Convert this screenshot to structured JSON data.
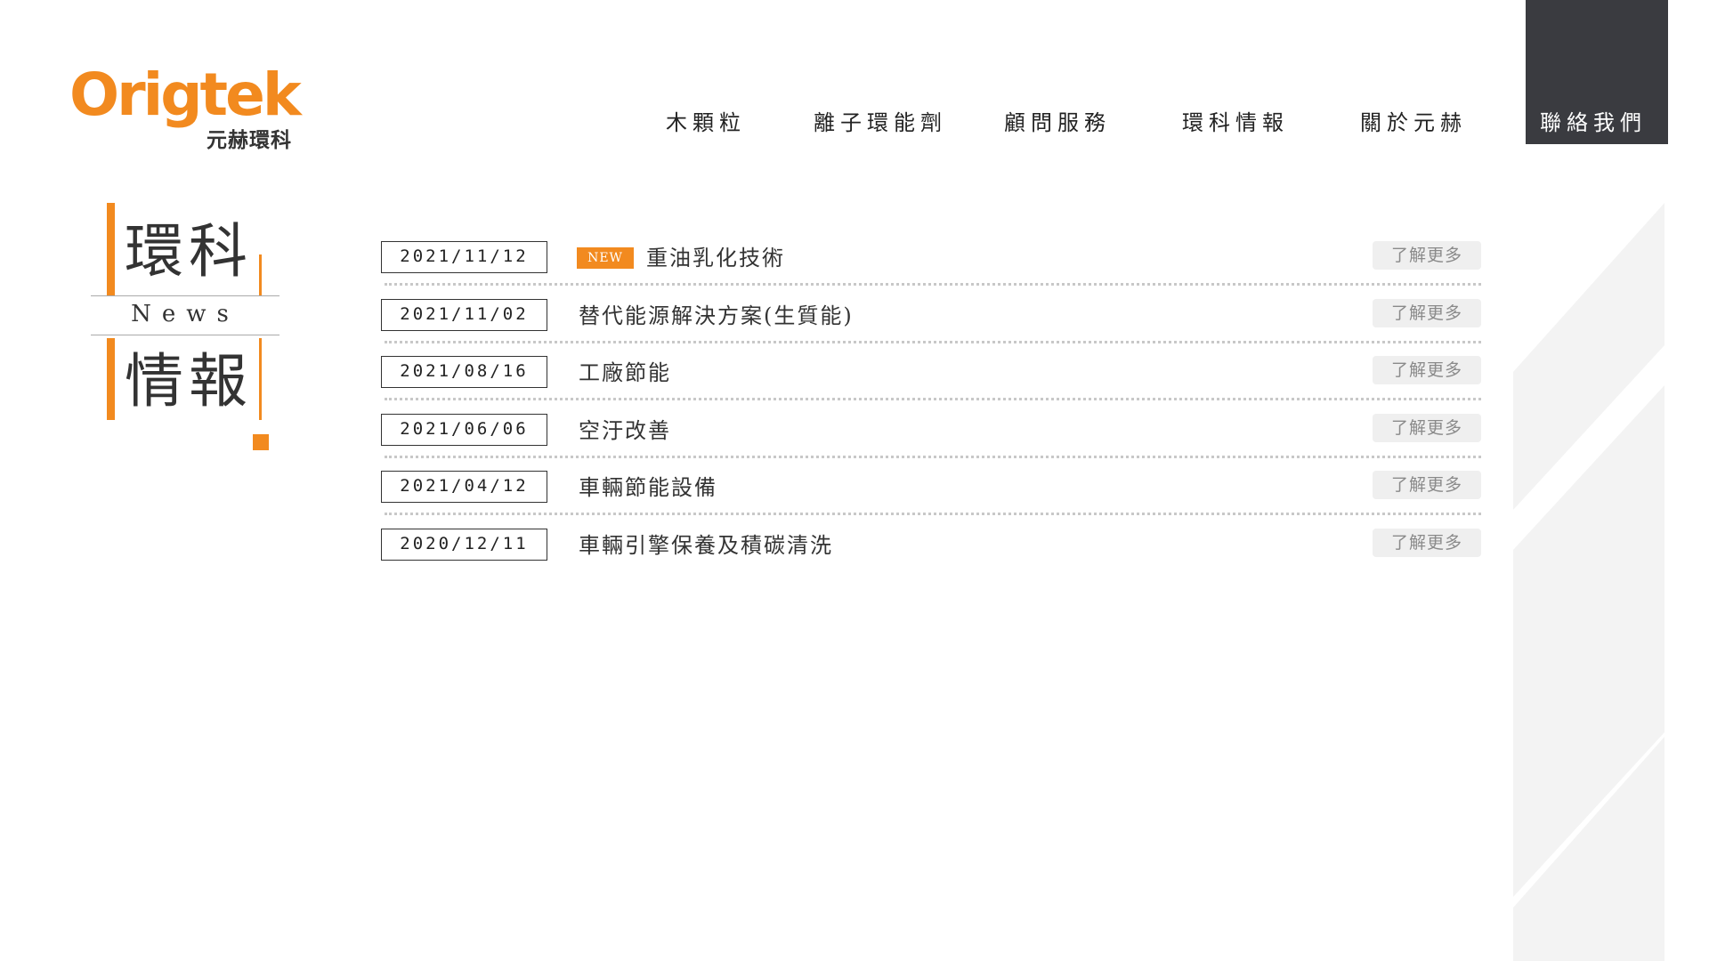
{
  "brand": {
    "logo_text": "Origtek",
    "logo_sub": "元赫環科",
    "accent": "#f28a1f",
    "dark": "#3a3b40"
  },
  "nav": {
    "items": [
      {
        "label": "木顆粒"
      },
      {
        "label": "離子環能劑"
      },
      {
        "label": "顧問服務"
      },
      {
        "label": "環科情報"
      },
      {
        "label": "關於元赫"
      }
    ],
    "contact_label": "聯絡我們"
  },
  "section": {
    "title_top": "環科",
    "title_en": "News",
    "title_bottom": "情報"
  },
  "news": [
    {
      "date": "2021/11/12",
      "badge": "NEW",
      "title": "重油乳化技術",
      "more": "了解更多"
    },
    {
      "date": "2021/11/02",
      "badge": "",
      "title": "替代能源解決方案(生質能)",
      "more": "了解更多"
    },
    {
      "date": "2021/08/16",
      "badge": "",
      "title": "工廠節能",
      "more": "了解更多"
    },
    {
      "date": "2021/06/06",
      "badge": "",
      "title": "空汙改善",
      "more": "了解更多"
    },
    {
      "date": "2021/04/12",
      "badge": "",
      "title": "車輛節能設備",
      "more": "了解更多"
    },
    {
      "date": "2020/12/11",
      "badge": "",
      "title": "車輛引擎保養及積碳清洗",
      "more": "了解更多"
    }
  ]
}
